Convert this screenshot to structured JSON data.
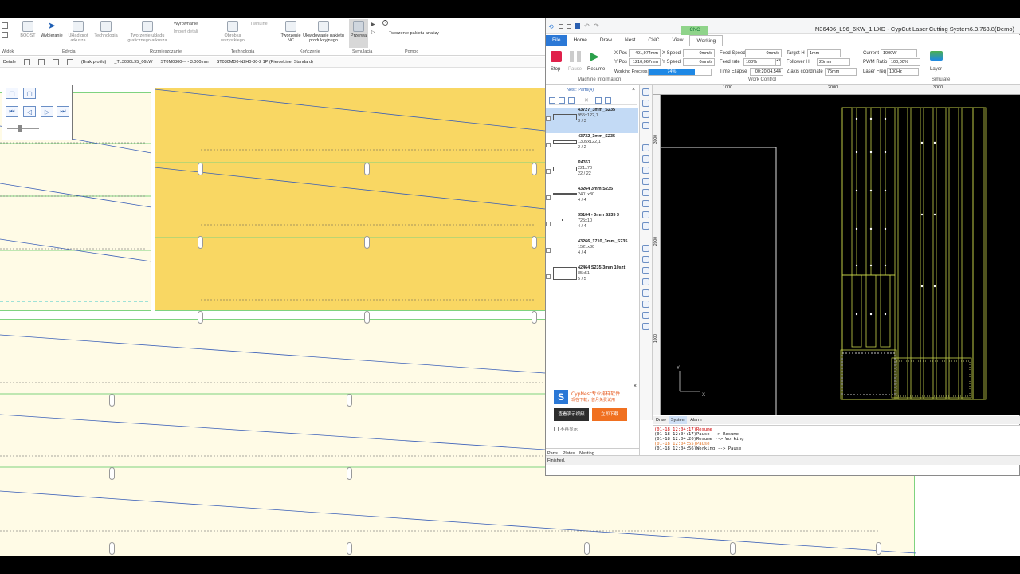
{
  "cad": {
    "ribbon": {
      "buttons": [
        {
          "label": "BOOST"
        },
        {
          "label": "Wybieranie"
        },
        {
          "label": "Układ grot arkusza"
        },
        {
          "label": "Technologia"
        },
        {
          "label": "Tworzenie układu graficznego arkusza"
        },
        {
          "label": "Obróbka wszystkiego"
        },
        {
          "label": "Tworzenie NC"
        },
        {
          "label": "Ukwidowanie pakietu produkcyjnego"
        },
        {
          "label": "Przerwa"
        }
      ],
      "small_buttons": {
        "wyrownanie": "Wyrównanie",
        "import": "Import detali",
        "twinline": "TwinLine",
        "analysis": "Tworzenie pakietu analizy"
      },
      "groups": [
        "Widok",
        "Edycja",
        "Rozmieszczanie",
        "Technologia",
        "Kończenie",
        "Symulacja",
        "Pomoc"
      ]
    },
    "detailbar": {
      "detale": "Detale",
      "profile": "(Brak profilu)",
      "program": "_TL3030L95_06kW",
      "material": "ST0M0300--- - 3.000mm",
      "technology": "ST030MD0-N2H0-30-2 1P (PierceLine: Standard)"
    }
  },
  "cypcut": {
    "title": "N36406_L96_6KW_1.LXD - CypCut Laser Cutting System6.3.763.8(Demo)",
    "context_tab": "CNC",
    "tabs": [
      "File",
      "Home",
      "Draw",
      "Nest",
      "CNC",
      "View",
      "Working"
    ],
    "active_tab": "Working",
    "machine": {
      "stop": "Stop",
      "pause": "Pause",
      "resume": "Resume",
      "group_label": "Machine Information",
      "x_pos_label": "X Pos",
      "x_pos": "491,974mm",
      "y_pos_label": "Y Pos",
      "y_pos": "1210,067mm",
      "x_speed_label": "X Speed",
      "x_speed": "0mm/s",
      "y_speed_label": "Y Speed",
      "y_speed": "0mm/s",
      "working_label": "Working Process",
      "progress_text": "74%",
      "progress": 0.74
    },
    "work_control": {
      "group_label": "Work Control",
      "feed_speed_label": "Feed Speed",
      "feed_speed": "0mm/s",
      "feed_rate_label": "Feed rate",
      "feed_rate": "100%",
      "time_ellapse_label": "Time Ellapse",
      "time_ellapse": "00:20:04.544",
      "target_h_label": "Target H",
      "target_h": "1mm",
      "follower_h_label": "Follower H",
      "follower_h": "25mm",
      "z_axis_label": "Z axis coordinate",
      "z_axis": "75mm",
      "current_label": "Current",
      "current": "1000W",
      "pwm_label": "PWM Ratio",
      "pwm": "100,00%",
      "laser_freq_label": "Laser Freq",
      "laser_freq": "100Hz",
      "layer": "Layer",
      "simulate": "Simulate"
    },
    "nest": {
      "header": "Nest: Parts(4)",
      "parts": [
        {
          "name": "43727_3mm_S235",
          "dims": "955x122,1",
          "count": "3 / 3"
        },
        {
          "name": "43732_3mm_S235",
          "dims": "1305x122,1",
          "count": "2 / 2"
        },
        {
          "name": "P4367",
          "dims": "221x70",
          "count": "22 / 22"
        },
        {
          "name": "43264 3mm S235",
          "dims": "2401x30",
          "count": "4 / 4"
        },
        {
          "name": "35104 - 3mm S235 3",
          "dims": "725x10",
          "count": "4 / 4"
        },
        {
          "name": "43266_1710_3mm_S235",
          "dims": "1521x30",
          "count": "4 / 4"
        },
        {
          "name": "42464 S235 3mm 10szt",
          "dims": "85x51",
          "count": "5 / 5"
        }
      ]
    },
    "ad": {
      "title": "CypNest专业排样软件",
      "subtitle": "现在下载，首月免费试用",
      "demo_button": "查看演示视频",
      "download_button": "立即下载",
      "checkbox": "不再显示"
    },
    "left_tabs": [
      "Parts",
      "Plates",
      "Nesting"
    ],
    "ruler_marks": [
      "1000",
      "2000",
      "3000",
      "1000",
      "2000",
      "3000"
    ],
    "bottom_tabs": [
      "Draw",
      "System",
      "Alarm"
    ],
    "log": [
      "(01-18 12:04:17)Resume",
      "(01-18 12:04:17)Pause --> Resume",
      "(01-18 12:04:20)Resume --> Working",
      "(01-18 12:04:55)Pause",
      "(01-18 12:04:56)Working --> Pause"
    ],
    "status": "Finished."
  }
}
